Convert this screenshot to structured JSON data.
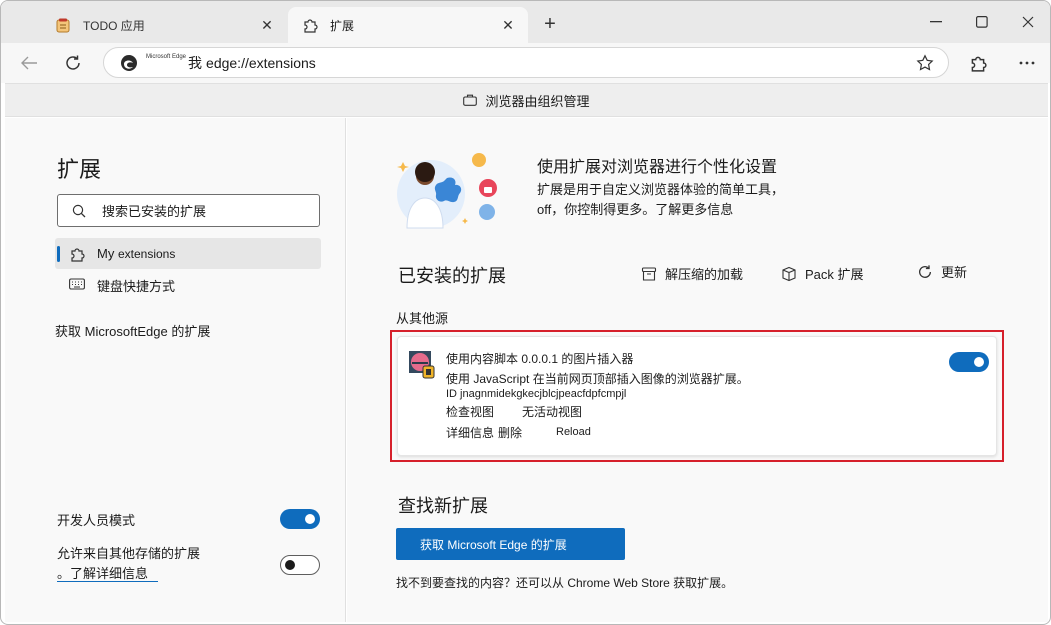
{
  "tabs": [
    {
      "label": "TODO 应用",
      "icon": "notepad-icon",
      "active": false
    },
    {
      "label": "扩展",
      "icon": "puzzle-icon",
      "active": true
    }
  ],
  "address_bar": {
    "identity_label": "Microsoft Edge",
    "identity_char": "我",
    "url": "edge://extensions"
  },
  "managed_banner": "浏览器由组织管理",
  "sidebar": {
    "title": "扩展",
    "search_placeholder": "搜索已安装的扩展",
    "nav": [
      {
        "label_a": "My",
        "label_b": "extensions",
        "selected": true
      },
      {
        "label_a": "键盘快捷方式",
        "label_b": "",
        "selected": false
      }
    ],
    "get_extensions": "获取 MicrosoftEdge 的扩展",
    "dev_mode_label": "开发人员模式",
    "dev_mode_on": true,
    "allow_other_line1": "允许来自其他存储的扩展",
    "allow_other_line2": "。了解详细信息",
    "allow_other_on": false
  },
  "main": {
    "hero_title": "使用扩展对浏览器进行个性化设置",
    "hero_desc_1": "扩展是用于自定义浏览器体验的简单工具，",
    "hero_desc_2": "off，你控制得更多。了解更多信息",
    "installed_title": "已安装的扩展",
    "actions": {
      "load_unpacked": "解压缩的加载",
      "pack": "Pack 扩展",
      "update": "更新"
    },
    "from_other_sources": "从其他源",
    "extension": {
      "name": "使用内容脚本 0.0.0.1 的图片插入器",
      "description": "使用 JavaScript 在当前网页顶部插入图像的浏览器扩展。",
      "id": "ID jnagnmidekgkecjblcjpeacfdpfcmpjl",
      "inspect_views": "检查视图",
      "no_active_views": "无活动视图",
      "details": "详细信息",
      "remove": "删除",
      "reload": "Reload",
      "enabled": true
    },
    "find_title": "查找新扩展",
    "get_button": "获取 Microsoft Edge 的扩展",
    "not_found": "找不到要查找的内容？还可以从 Chrome Web Store 获取扩展。"
  }
}
